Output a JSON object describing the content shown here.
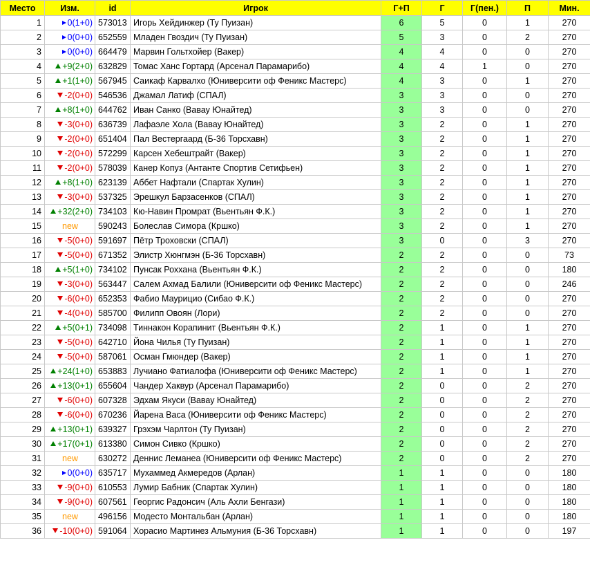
{
  "headers": [
    "Место",
    "Изм.",
    "id",
    "Игрок",
    "Г+П",
    "Г",
    "Г(пен.)",
    "П",
    "Мин."
  ],
  "colors": {
    "header": "#ffff00",
    "gp": "#99ff99",
    "up": "#008000",
    "down": "#e00000",
    "same": "#0000ff",
    "new": "#ff9900"
  },
  "rows": [
    {
      "rank": "1",
      "dir": "same",
      "change": "0(1+0)",
      "id": "573013",
      "player": "Игорь Хейдинжер (Ту Пуизан)",
      "gp": "6",
      "g": "5",
      "pen": "0",
      "a": "1",
      "min": "270"
    },
    {
      "rank": "2",
      "dir": "same",
      "change": "0(0+0)",
      "id": "652559",
      "player": "Младен Гвоздич (Ту Пуизан)",
      "gp": "5",
      "g": "3",
      "pen": "0",
      "a": "2",
      "min": "270"
    },
    {
      "rank": "3",
      "dir": "same",
      "change": "0(0+0)",
      "id": "664479",
      "player": "Марвин Гольтхойер (Вакер)",
      "gp": "4",
      "g": "4",
      "pen": "0",
      "a": "0",
      "min": "270"
    },
    {
      "rank": "4",
      "dir": "up",
      "change": "+9(2+0)",
      "id": "632829",
      "player": "Томас Ханс Гортард (Арсенал Парамарибо)",
      "gp": "4",
      "g": "4",
      "pen": "1",
      "a": "0",
      "min": "270"
    },
    {
      "rank": "5",
      "dir": "up",
      "change": "+1(1+0)",
      "id": "567945",
      "player": "Саикаф Карвалхо (Юниверсити оф Феникс Мастерс)",
      "gp": "4",
      "g": "3",
      "pen": "0",
      "a": "1",
      "min": "270"
    },
    {
      "rank": "6",
      "dir": "down",
      "change": "-2(0+0)",
      "id": "546536",
      "player": "Джамал Латиф (СПАЛ)",
      "gp": "3",
      "g": "3",
      "pen": "0",
      "a": "0",
      "min": "270"
    },
    {
      "rank": "7",
      "dir": "up",
      "change": "+8(1+0)",
      "id": "644762",
      "player": "Иван Санко (Вавау Юнайтед)",
      "gp": "3",
      "g": "3",
      "pen": "0",
      "a": "0",
      "min": "270"
    },
    {
      "rank": "8",
      "dir": "down",
      "change": "-3(0+0)",
      "id": "636739",
      "player": "Лафаэле Хола (Вавау Юнайтед)",
      "gp": "3",
      "g": "2",
      "pen": "0",
      "a": "1",
      "min": "270"
    },
    {
      "rank": "9",
      "dir": "down",
      "change": "-2(0+0)",
      "id": "651404",
      "player": "Пал Вестергаард (Б-36 Торсхавн)",
      "gp": "3",
      "g": "2",
      "pen": "0",
      "a": "1",
      "min": "270"
    },
    {
      "rank": "10",
      "dir": "down",
      "change": "-2(0+0)",
      "id": "572299",
      "player": "Карсен Хебештрайт (Вакер)",
      "gp": "3",
      "g": "2",
      "pen": "0",
      "a": "1",
      "min": "270"
    },
    {
      "rank": "11",
      "dir": "down",
      "change": "-2(0+0)",
      "id": "578039",
      "player": "Канер Копуз (Антанте Спортив Сетифьен)",
      "gp": "3",
      "g": "2",
      "pen": "0",
      "a": "1",
      "min": "270"
    },
    {
      "rank": "12",
      "dir": "up",
      "change": "+8(1+0)",
      "id": "623139",
      "player": "Аббет Нафтали (Спартак Хулин)",
      "gp": "3",
      "g": "2",
      "pen": "0",
      "a": "1",
      "min": "270"
    },
    {
      "rank": "13",
      "dir": "down",
      "change": "-3(0+0)",
      "id": "537325",
      "player": "Эрешкул Барзасенков (СПАЛ)",
      "gp": "3",
      "g": "2",
      "pen": "0",
      "a": "1",
      "min": "270"
    },
    {
      "rank": "14",
      "dir": "up",
      "change": "+32(2+0)",
      "id": "734103",
      "player": "Кю-Навин Промрат (Вьентьян Ф.К.)",
      "gp": "3",
      "g": "2",
      "pen": "0",
      "a": "1",
      "min": "270"
    },
    {
      "rank": "15",
      "dir": "new",
      "change": "new",
      "id": "590243",
      "player": "Болеслав Симора (Кршко)",
      "gp": "3",
      "g": "2",
      "pen": "0",
      "a": "1",
      "min": "270"
    },
    {
      "rank": "16",
      "dir": "down",
      "change": "-5(0+0)",
      "id": "591697",
      "player": "Пётр Троховски (СПАЛ)",
      "gp": "3",
      "g": "0",
      "pen": "0",
      "a": "3",
      "min": "270"
    },
    {
      "rank": "17",
      "dir": "down",
      "change": "-5(0+0)",
      "id": "671352",
      "player": "Элистр Хюнгмэн (Б-36 Торсхавн)",
      "gp": "2",
      "g": "2",
      "pen": "0",
      "a": "0",
      "min": "73"
    },
    {
      "rank": "18",
      "dir": "up",
      "change": "+5(1+0)",
      "id": "734102",
      "player": "Пунсак Роххана (Вьентьян Ф.К.)",
      "gp": "2",
      "g": "2",
      "pen": "0",
      "a": "0",
      "min": "180"
    },
    {
      "rank": "19",
      "dir": "down",
      "change": "-3(0+0)",
      "id": "563447",
      "player": "Салем Ахмад Балили (Юниверсити оф Феникс Мастерс)",
      "gp": "2",
      "g": "2",
      "pen": "0",
      "a": "0",
      "min": "246"
    },
    {
      "rank": "20",
      "dir": "down",
      "change": "-6(0+0)",
      "id": "652353",
      "player": "Фабио Маурицио (Сибао Ф.К.)",
      "gp": "2",
      "g": "2",
      "pen": "0",
      "a": "0",
      "min": "270"
    },
    {
      "rank": "21",
      "dir": "down",
      "change": "-4(0+0)",
      "id": "585700",
      "player": "Филипп Овоян (Лори)",
      "gp": "2",
      "g": "2",
      "pen": "0",
      "a": "0",
      "min": "270"
    },
    {
      "rank": "22",
      "dir": "up",
      "change": "+5(0+1)",
      "id": "734098",
      "player": "Тиннакон Корапинит (Вьентьян Ф.К.)",
      "gp": "2",
      "g": "1",
      "pen": "0",
      "a": "1",
      "min": "270"
    },
    {
      "rank": "23",
      "dir": "down",
      "change": "-5(0+0)",
      "id": "642710",
      "player": "Йона Чилья (Ту Пуизан)",
      "gp": "2",
      "g": "1",
      "pen": "0",
      "a": "1",
      "min": "270"
    },
    {
      "rank": "24",
      "dir": "down",
      "change": "-5(0+0)",
      "id": "587061",
      "player": "Осман Гмюндер (Вакер)",
      "gp": "2",
      "g": "1",
      "pen": "0",
      "a": "1",
      "min": "270"
    },
    {
      "rank": "25",
      "dir": "up",
      "change": "+24(1+0)",
      "id": "653883",
      "player": "Лучиано Фатиалофа (Юниверсити оф Феникс Мастерс)",
      "gp": "2",
      "g": "1",
      "pen": "0",
      "a": "1",
      "min": "270"
    },
    {
      "rank": "26",
      "dir": "up",
      "change": "+13(0+1)",
      "id": "655604",
      "player": "Чандер Хаквур (Арсенал Парамарибо)",
      "gp": "2",
      "g": "0",
      "pen": "0",
      "a": "2",
      "min": "270"
    },
    {
      "rank": "27",
      "dir": "down",
      "change": "-6(0+0)",
      "id": "607328",
      "player": "Эдхам Якуси (Вавау Юнайтед)",
      "gp": "2",
      "g": "0",
      "pen": "0",
      "a": "2",
      "min": "270"
    },
    {
      "rank": "28",
      "dir": "down",
      "change": "-6(0+0)",
      "id": "670236",
      "player": "Йарена Васа (Юниверсити оф Феникс Мастерс)",
      "gp": "2",
      "g": "0",
      "pen": "0",
      "a": "2",
      "min": "270"
    },
    {
      "rank": "29",
      "dir": "up",
      "change": "+13(0+1)",
      "id": "639327",
      "player": "Грэхэм Чарлтон (Ту Пуизан)",
      "gp": "2",
      "g": "0",
      "pen": "0",
      "a": "2",
      "min": "270"
    },
    {
      "rank": "30",
      "dir": "up",
      "change": "+17(0+1)",
      "id": "613380",
      "player": "Симон Сивко (Кршко)",
      "gp": "2",
      "g": "0",
      "pen": "0",
      "a": "2",
      "min": "270"
    },
    {
      "rank": "31",
      "dir": "new",
      "change": "new",
      "id": "630272",
      "player": "Деннис Леманеа (Юниверсити оф Феникс Мастерс)",
      "gp": "2",
      "g": "0",
      "pen": "0",
      "a": "2",
      "min": "270"
    },
    {
      "rank": "32",
      "dir": "same",
      "change": "0(0+0)",
      "id": "635717",
      "player": "Мухаммед Акмередов (Арлан)",
      "gp": "1",
      "g": "1",
      "pen": "0",
      "a": "0",
      "min": "180"
    },
    {
      "rank": "33",
      "dir": "down",
      "change": "-9(0+0)",
      "id": "610553",
      "player": "Лумир Бабник (Спартак Хулин)",
      "gp": "1",
      "g": "1",
      "pen": "0",
      "a": "0",
      "min": "180"
    },
    {
      "rank": "34",
      "dir": "down",
      "change": "-9(0+0)",
      "id": "607561",
      "player": "Георгис Радонсич (Аль Ахли Бенгази)",
      "gp": "1",
      "g": "1",
      "pen": "0",
      "a": "0",
      "min": "180"
    },
    {
      "rank": "35",
      "dir": "new",
      "change": "new",
      "id": "496156",
      "player": "Модесто Монтальбан (Арлан)",
      "gp": "1",
      "g": "1",
      "pen": "0",
      "a": "0",
      "min": "180"
    },
    {
      "rank": "36",
      "dir": "down",
      "change": "-10(0+0)",
      "id": "591064",
      "player": "Хорасио Мартинез Альмуния (Б-36 Торсхавн)",
      "gp": "1",
      "g": "1",
      "pen": "0",
      "a": "0",
      "min": "197"
    }
  ]
}
